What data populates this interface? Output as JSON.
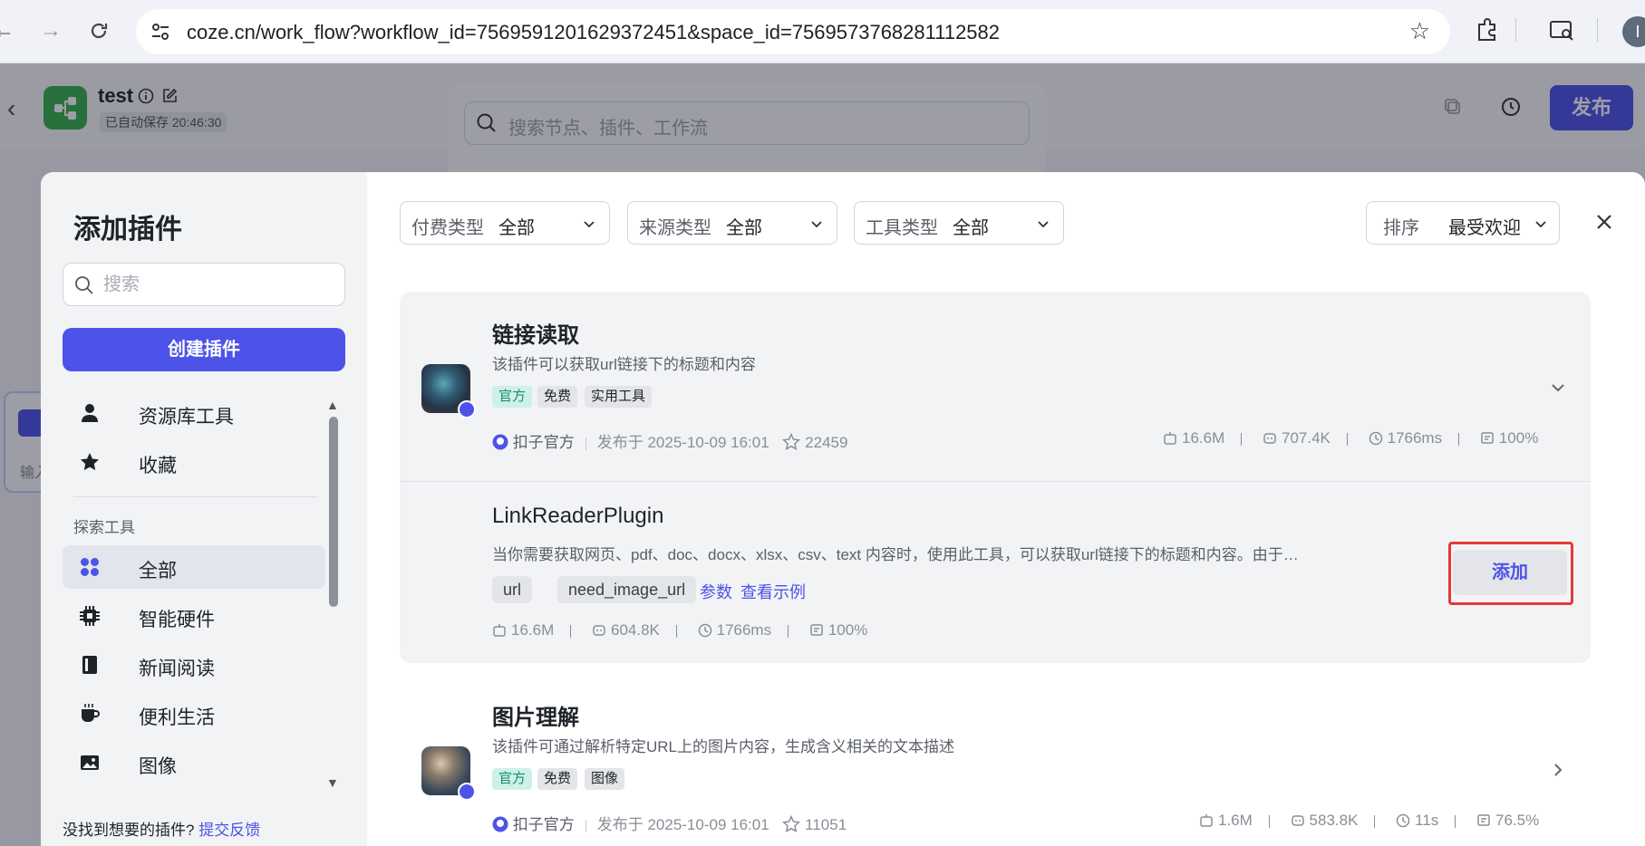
{
  "browser": {
    "url": "coze.cn/work_flow?workflow_id=7569591201629372451&space_id=7569573768281112582",
    "profile_initial": "I"
  },
  "app": {
    "workflow_title": "test",
    "autosave": "已自动保存 20:46:30",
    "node_search_placeholder": "搜索节点、插件、工作流",
    "publish_label": "发布",
    "canvas_node_text": "输入"
  },
  "modal": {
    "title": "添加插件",
    "search_placeholder": "搜索",
    "create_label": "创建插件",
    "nav_top": [
      {
        "label": "资源库工具",
        "icon": "person-icon"
      },
      {
        "label": "收藏",
        "icon": "star-icon"
      }
    ],
    "section_label": "探索工具",
    "nav_categories": [
      {
        "label": "全部",
        "icon": "grid-icon",
        "active": true
      },
      {
        "label": "智能硬件",
        "icon": "chip-icon"
      },
      {
        "label": "新闻阅读",
        "icon": "book-icon"
      },
      {
        "label": "便利生活",
        "icon": "cup-icon"
      },
      {
        "label": "图像",
        "icon": "image-icon"
      }
    ],
    "footer_text": "没找到想要的插件?",
    "footer_link": "提交反馈"
  },
  "filters": [
    {
      "key": "付费类型",
      "value": "全部"
    },
    {
      "key": "来源类型",
      "value": "全部"
    },
    {
      "key": "工具类型",
      "value": "全部"
    }
  ],
  "sort": {
    "key": "排序",
    "value": "最受欢迎"
  },
  "plugins": [
    {
      "title": "链接读取",
      "description": "该插件可以获取url链接下的标题和内容",
      "tags": [
        "官方",
        "免费",
        "实用工具"
      ],
      "publisher": "扣子官方",
      "published": "发布于 2025-10-09 16:01",
      "favorites": "22459",
      "stats": [
        "16.6M",
        "707.4K",
        "1766ms",
        "100%"
      ]
    },
    {
      "title": "图片理解",
      "description": "该插件可通过解析特定URL上的图片内容，生成含义相关的文本描述",
      "tags": [
        "官方",
        "免费",
        "图像"
      ],
      "publisher": "扣子官方",
      "published": "发布于 2025-10-09 16:01",
      "favorites": "11051",
      "stats": [
        "1.6M",
        "583.8K",
        "11s",
        "76.5%"
      ]
    }
  ],
  "tool": {
    "title": "LinkReaderPlugin",
    "description": "当你需要获取网页、pdf、doc、docx、xlsx、csv、text 内容时，使用此工具，可以获取url链接下的标题和内容。由于…",
    "params": [
      "url",
      "need_image_url"
    ],
    "params_link": "参数",
    "example_link": "查看示例",
    "stats": [
      "16.6M",
      "604.8K",
      "1766ms",
      "100%"
    ],
    "add_label": "添加"
  }
}
